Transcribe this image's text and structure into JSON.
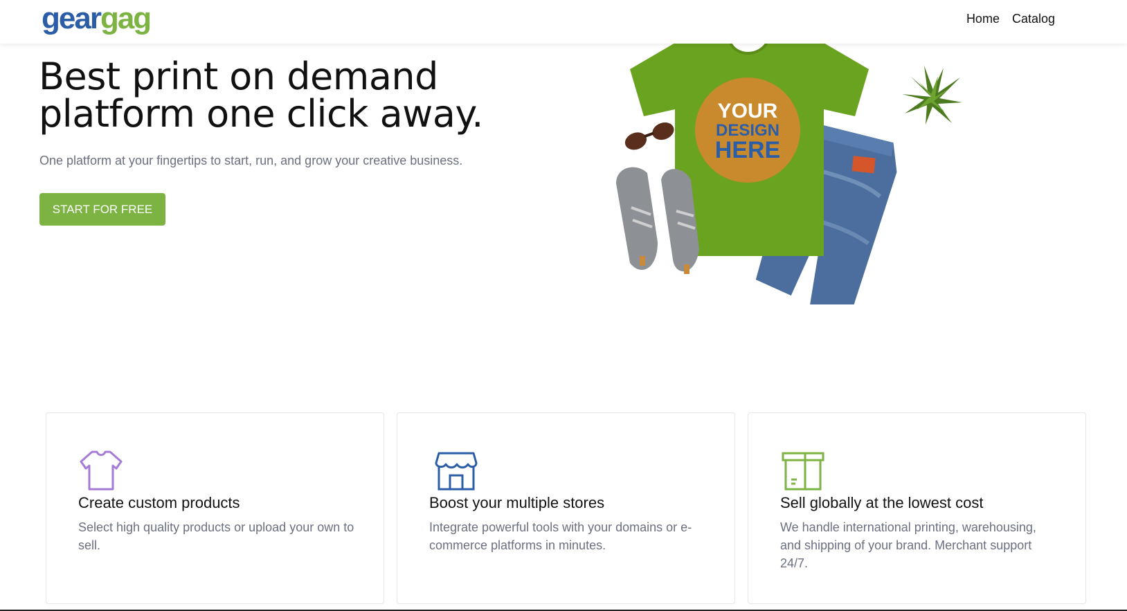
{
  "header": {
    "logo": {
      "part1": "gear",
      "part2": "gag"
    },
    "nav": [
      {
        "label": "Home"
      },
      {
        "label": "Catalog"
      }
    ]
  },
  "hero": {
    "title_line1": "Best print on demand",
    "title_line2": "platform one click away.",
    "subtitle": "One platform at your fingertips to start, run, and grow your creative business.",
    "cta_label": "START FOR FREE",
    "image_text": {
      "line1": "YOUR",
      "line2": "DESIGN",
      "line3": "HERE"
    }
  },
  "features": [
    {
      "icon": "tshirt-icon",
      "title": "Create custom products",
      "text": "Select high quality products or upload your own to sell."
    },
    {
      "icon": "store-icon",
      "title": "Boost your multiple stores",
      "text": "Integrate powerful tools with your domains or e-commerce platforms in minutes."
    },
    {
      "icon": "box-icon",
      "title": "Sell globally at the lowest cost",
      "text": "We handle international printing, warehousing, and shipping of your brand. Merchant support 24/7."
    }
  ],
  "colors": {
    "brand_blue": "#2b5ea7",
    "brand_green": "#7cb342",
    "muted_text": "#6b6f80"
  }
}
